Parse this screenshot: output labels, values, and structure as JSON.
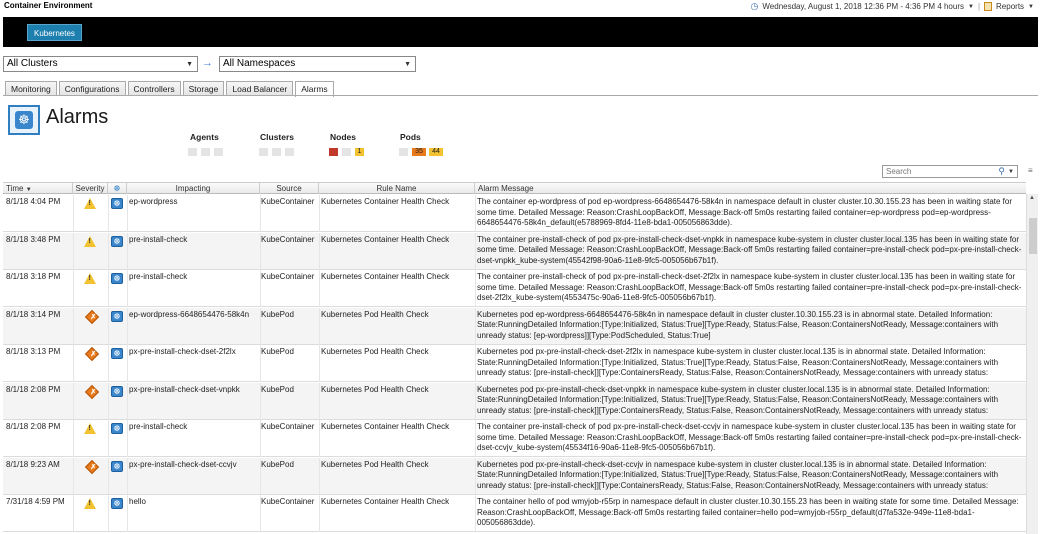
{
  "app": {
    "title": "Container Environment"
  },
  "top_right": {
    "datetime": "Wednesday, August 1, 2018 12:36 PM - 4:36 PM 4 hours",
    "reports": "Reports"
  },
  "nav": {
    "kubernetes_tab": "Kubernetes"
  },
  "filters": {
    "clusters": "All Clusters",
    "namespaces": "All Namespaces"
  },
  "tabs": [
    "Monitoring",
    "Configurations",
    "Controllers",
    "Storage",
    "Load Balancer",
    "Alarms"
  ],
  "page": {
    "title": "Alarms"
  },
  "summary": {
    "agents": "Agents",
    "clusters": "Clusters",
    "nodes": "Nodes",
    "pods": "Pods",
    "nodes_counts": [
      "",
      "",
      "1"
    ],
    "pods_counts": [
      "",
      "35",
      "44"
    ]
  },
  "colors": {
    "critical": "#c0392b",
    "major": "#e87a1c",
    "warning": "#f2c230",
    "accent": "#1c7fae"
  },
  "search": {
    "placeholder": "Search"
  },
  "table": {
    "headers": {
      "time": "Time",
      "severity": "Severity",
      "impacting": "Impacting",
      "source": "Source",
      "rule": "Rule Name",
      "message": "Alarm Message"
    },
    "rows": [
      {
        "time": "8/1/18 4:04 PM",
        "severity": "warning",
        "impacting": "ep-wordpress",
        "source": "KubeContainer",
        "rule": "Kubernetes Container Health Check",
        "message": "The container ep-wordpress of pod ep-wordpress-6648654476-58k4n in namespace default in cluster cluster.10.30.155.23 has been in waiting state for some time. Detailed Message: Reason:CrashLoopBackOff, Message:Back-off 5m0s restarting failed container=ep-wordpress pod=ep-wordpress-6648654476-58k4n_default(e5788969-8fd4-11e8-bda1-005056863dde)."
      },
      {
        "time": "8/1/18 3:48 PM",
        "severity": "warning",
        "impacting": "pre-install-check",
        "source": "KubeContainer",
        "rule": "Kubernetes Container Health Check",
        "message": "The container pre-install-check of pod px-pre-install-check-dset-vnpkk in namespace kube-system in cluster cluster.local.135 has been in waiting state for some time. Detailed Message: Reason:CrashLoopBackOff, Message:Back-off 5m0s restarting failed container=pre-install-check pod=px-pre-install-check-dset-vnpkk_kube-system(45542f98-90a6-11e8-9fc5-005056b67b1f)."
      },
      {
        "time": "8/1/18 3:18 PM",
        "severity": "warning",
        "impacting": "pre-install-check",
        "source": "KubeContainer",
        "rule": "Kubernetes Container Health Check",
        "message": "The container pre-install-check of pod px-pre-install-check-dset-2f2lx in namespace kube-system in cluster cluster.local.135 has been in waiting state for some time. Detailed Message: Reason:CrashLoopBackOff, Message:Back-off 5m0s restarting failed container=pre-install-check pod=px-pre-install-check-dset-2f2lx_kube-system(4553475c-90a6-11e8-9fc5-005056b67b1f)."
      },
      {
        "time": "8/1/18 3:14 PM",
        "severity": "critical",
        "impacting": "ep-wordpress-6648654476-58k4n",
        "source": "KubePod",
        "rule": "Kubernetes Pod Health Check",
        "message": "Kubernetes pod ep-wordpress-6648654476-58k4n in namespace default in cluster cluster.10.30.155.23 is in abnormal state. Detailed Information: State:RunningDetailed Information:[Type:Initialized, Status:True][Type:Ready, Status:False, Reason:ContainersNotReady, Message:containers with unready status: [ep-wordpress]][Type:PodScheduled, Status:True]"
      },
      {
        "time": "8/1/18 3:13 PM",
        "severity": "critical",
        "impacting": "px-pre-install-check-dset-2f2lx",
        "source": "KubePod",
        "rule": "Kubernetes Pod Health Check",
        "message": "Kubernetes pod px-pre-install-check-dset-2f2lx in namespace kube-system in cluster cluster.local.135 is in abnormal state. Detailed Information: State:RunningDetailed Information:[Type:Initialized, Status:True][Type:Ready, Status:False, Reason:ContainersNotReady, Message:containers with unready status: [pre-install-check]][Type:ContainersReady, Status:False, Reason:ContainersNotReady, Message:containers with unready status:"
      },
      {
        "time": "8/1/18 2:08 PM",
        "severity": "critical",
        "impacting": "px-pre-install-check-dset-vnpkk",
        "source": "KubePod",
        "rule": "Kubernetes Pod Health Check",
        "message": "Kubernetes pod px-pre-install-check-dset-vnpkk in namespace kube-system in cluster cluster.local.135 is in abnormal state. Detailed Information: State:RunningDetailed Information:[Type:Initialized, Status:True][Type:Ready, Status:False, Reason:ContainersNotReady, Message:containers with unready status: [pre-install-check]][Type:ContainersReady, Status:False, Reason:ContainersNotReady, Message:containers with unready status:"
      },
      {
        "time": "8/1/18 2:08 PM",
        "severity": "warning",
        "impacting": "pre-install-check",
        "source": "KubeContainer",
        "rule": "Kubernetes Container Health Check",
        "message": "The container pre-install-check of pod px-pre-install-check-dset-ccvjv in namespace kube-system in cluster cluster.local.135 has been in waiting state for some time. Detailed Message: Reason:CrashLoopBackOff, Message:Back-off 5m0s restarting failed container=pre-install-check pod=px-pre-install-check-dset-ccvjv_kube-system(45534f16-90a6-11e8-9fc5-005056b67b1f)."
      },
      {
        "time": "8/1/18 9:23 AM",
        "severity": "critical",
        "impacting": "px-pre-install-check-dset-ccvjv",
        "source": "KubePod",
        "rule": "Kubernetes Pod Health Check",
        "message": "Kubernetes pod px-pre-install-check-dset-ccvjv in namespace kube-system in cluster cluster.local.135 is in abnormal state. Detailed Information: State:RunningDetailed Information:[Type:Initialized, Status:True][Type:Ready, Status:False, Reason:ContainersNotReady, Message:containers with unready status: [pre-install-check]][Type:ContainersReady, Status:False, Reason:ContainersNotReady, Message:containers with unready status:"
      },
      {
        "time": "7/31/18 4:59 PM",
        "severity": "warning",
        "impacting": "hello",
        "source": "KubeContainer",
        "rule": "Kubernetes Container Health Check",
        "message": "The container hello of pod wmyjob-r55rp in namespace default in cluster cluster.10.30.155.23 has been in waiting state for some time. Detailed Message: Reason:CrashLoopBackOff, Message:Back-off 5m0s restarting failed container=hello pod=wmyjob-r55rp_default(d7fa532e-949e-11e8-bda1-005056863dde)."
      }
    ]
  }
}
